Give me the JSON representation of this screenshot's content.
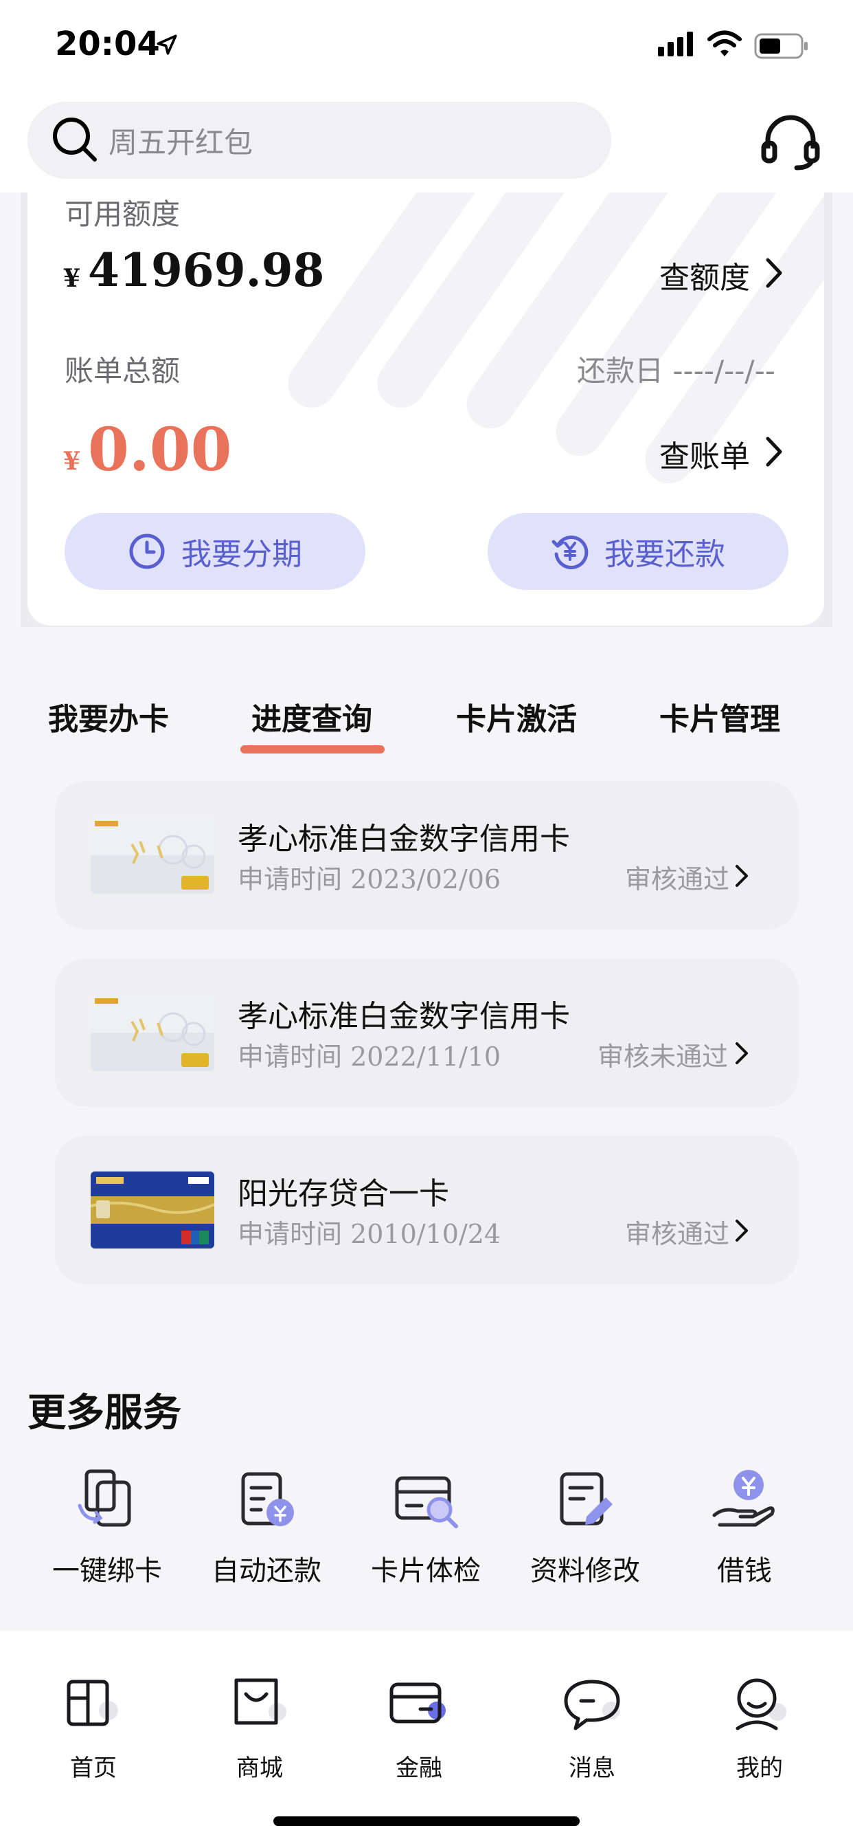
{
  "status_bar": {
    "time": "20:04"
  },
  "search": {
    "placeholder": "周五开红包"
  },
  "balance": {
    "credit_label": "可用额度",
    "currency_symbol": "¥",
    "credit_amount": "41969.98",
    "check_credit": "查额度",
    "bill_label": "账单总额",
    "due_date": "还款日 ----/--/--",
    "bill_amount": "0.00",
    "check_bill": "查账单",
    "installment_button": "我要分期",
    "repay_button": "我要还款"
  },
  "tabs": [
    {
      "label": "我要办卡"
    },
    {
      "label": "进度查询",
      "active": true
    },
    {
      "label": "卡片激活"
    },
    {
      "label": "卡片管理"
    }
  ],
  "cards": [
    {
      "title": "孝心标准白金数字信用卡",
      "date": "申请时间 2023/02/06",
      "status": "审核通过",
      "thumb": "white-platinum-card"
    },
    {
      "title": "孝心标准白金数字信用卡",
      "date": "申请时间 2022/11/10",
      "status": "审核未通过",
      "thumb": "white-platinum-card"
    },
    {
      "title": "阳光存贷合一卡",
      "date": "申请时间 2010/10/24",
      "status": "审核通过",
      "thumb": "blue-gold-card"
    }
  ],
  "more_services": {
    "title": "更多服务",
    "items": [
      {
        "label": "一键绑卡",
        "icon": "bind-card-icon"
      },
      {
        "label": "自动还款",
        "icon": "auto-repay-icon"
      },
      {
        "label": "卡片体检",
        "icon": "card-check-icon"
      },
      {
        "label": "资料修改",
        "icon": "edit-info-icon"
      },
      {
        "label": "借钱",
        "icon": "borrow-icon"
      }
    ]
  },
  "bottom_nav": [
    {
      "label": "首页",
      "icon": "home-icon"
    },
    {
      "label": "商城",
      "icon": "mall-icon"
    },
    {
      "label": "金融",
      "icon": "finance-icon",
      "active": true
    },
    {
      "label": "消息",
      "icon": "message-icon"
    },
    {
      "label": "我的",
      "icon": "profile-icon"
    }
  ],
  "colors": {
    "accent": "#e8735a",
    "button_bg": "#e0e2fb",
    "button_text": "#5a5fd0",
    "icon_accent": "#8e92ea"
  }
}
